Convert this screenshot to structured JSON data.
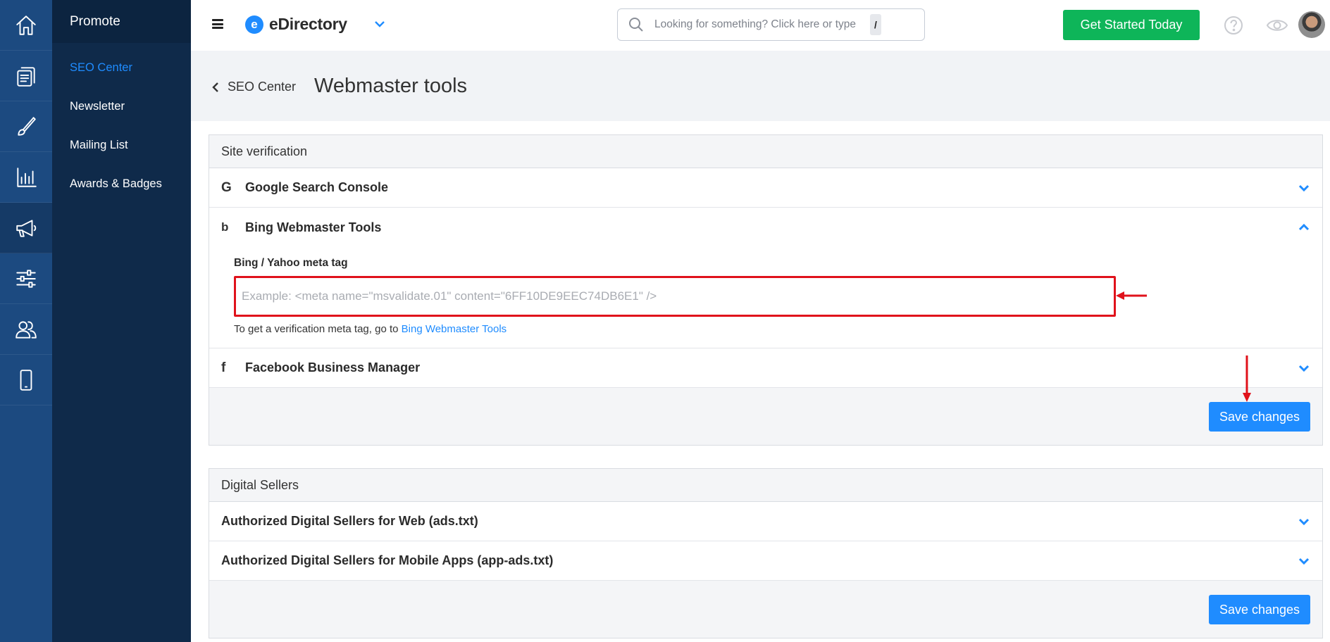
{
  "sidebar": {
    "rail": [
      "home-icon",
      "pages-icon",
      "brush-icon",
      "chart-icon",
      "megaphone-icon",
      "sliders-icon",
      "users-icon",
      "mobile-icon"
    ],
    "active_rail": "megaphone-icon",
    "section_title": "Promote",
    "items": [
      {
        "label": "SEO Center",
        "active": true
      },
      {
        "label": "Newsletter",
        "active": false
      },
      {
        "label": "Mailing List",
        "active": false
      },
      {
        "label": "Awards & Badges",
        "active": false
      }
    ]
  },
  "topbar": {
    "brand": "eDirectory",
    "brand_logo_letter": "e",
    "search_placeholder": "Looking for something? Click here or type",
    "search_shortcut": "/",
    "cta_label": "Get Started Today"
  },
  "header": {
    "back_label": "SEO Center",
    "title": "Webmaster tools"
  },
  "site_verification": {
    "title": "Site verification",
    "sections": {
      "google": {
        "label": "Google Search Console",
        "icon": "G"
      },
      "bing": {
        "label": "Bing Webmaster Tools",
        "icon": "b"
      },
      "facebook": {
        "label": "Facebook Business Manager",
        "icon": "f"
      }
    },
    "bing_field": {
      "label": "Bing / Yahoo meta tag",
      "placeholder": "Example: <meta name=\"msvalidate.01\" content=\"6FF10DE9EEC74DB6E1\" />",
      "value": "",
      "help_prefix": "To get a verification meta tag, go to",
      "help_link": "Bing Webmaster Tools"
    },
    "save_label": "Save changes"
  },
  "digital_sellers": {
    "title": "Digital Sellers",
    "items": [
      "Authorized Digital Sellers for Web (ads.txt)",
      "Authorized Digital Sellers for Mobile Apps (app-ads.txt)"
    ],
    "save_label": "Save changes"
  },
  "colors": {
    "rail_bg": "#1c4a80",
    "submenu_bg": "#0f2a4a",
    "accent": "#1f8cff",
    "cta": "#0eb559",
    "annotation": "#e0121b"
  }
}
